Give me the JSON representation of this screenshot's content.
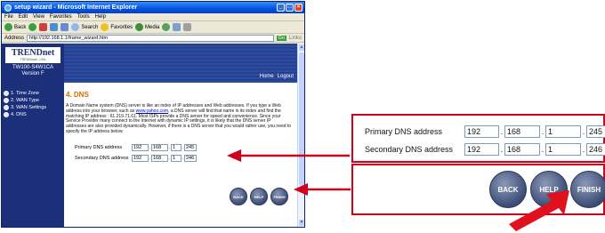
{
  "browser": {
    "title": "setup wizard - Microsoft Internet Explorer",
    "menu": [
      "File",
      "Edit",
      "View",
      "Favorites",
      "Tools",
      "Help"
    ],
    "toolbar": {
      "back": "Back",
      "search": "Search",
      "favorites": "Favorites",
      "media": "Media"
    },
    "address_label": "Address",
    "address_value": "http://192.168.1.1/frame_wizard.htm",
    "go": "Go",
    "links": "Links"
  },
  "sidebar": {
    "brand": "TRENDnet",
    "tagline": "TRENDware, USA",
    "model": "TW100-S4W1CA",
    "version": "Version F",
    "steps": [
      "1. Time Zone",
      "2. WAN Type",
      "3. WAN Settings",
      "4. DNS"
    ]
  },
  "header": {
    "home": "Home",
    "logout": "Logout"
  },
  "main": {
    "title": "4. DNS",
    "desc_part1": "A Domain Name system (DNS) server is like an index of IP addresses and Web addresses. If you type a Web address into your browser, such as ",
    "desc_link": "www.yahoo.com",
    "desc_part2": ", a DNS server will find that name in its index and find the matching IP address : 61.219.71.61. Most ISPs provide a DNS server for speed and convenience. Since your Service Provider many connect to the Internet with dynamic IP settings, it is likely that the DNS server IP addresses are also provided dynamically. However, if there is a DNS server that you would rather use, you need to specify the IP address below."
  },
  "dns": {
    "primary_label": "Primary DNS address",
    "primary": [
      "192",
      "168",
      "1",
      "245"
    ],
    "secondary_label": "Secondary DNS address",
    "secondary": [
      "192",
      "168",
      "1",
      "246"
    ]
  },
  "buttons": {
    "back": "BACK",
    "help": "HELP",
    "finish": "FINISH"
  },
  "colors": {
    "callout": "#d0021b",
    "sidebar": "#1b2f7a",
    "title": "#e06a00"
  }
}
